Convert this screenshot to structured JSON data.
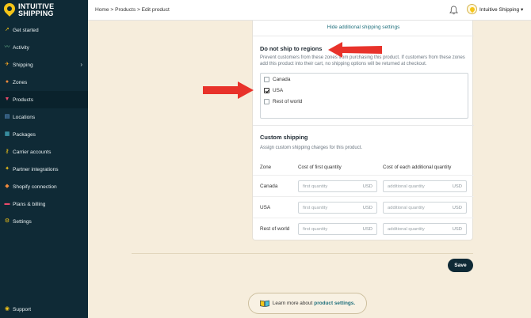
{
  "brand": {
    "line1": "INTUITIVE",
    "line2": "SHIPPING"
  },
  "sidebar": {
    "items": [
      {
        "label": "Get started",
        "icon": "rocket-icon"
      },
      {
        "label": "Activity",
        "icon": "activity-icon"
      },
      {
        "label": "Shipping",
        "icon": "shipping-icon",
        "chevron": "›"
      },
      {
        "label": "Zones",
        "icon": "globe-icon"
      },
      {
        "label": "Products",
        "icon": "shirt-icon"
      },
      {
        "label": "Locations",
        "icon": "building-icon"
      },
      {
        "label": "Packages",
        "icon": "boxes-icon"
      },
      {
        "label": "Carrier accounts",
        "icon": "key-icon"
      },
      {
        "label": "Partner integrations",
        "icon": "sparkle-icon"
      },
      {
        "label": "Shopify connection",
        "icon": "shopify-icon"
      },
      {
        "label": "Plans & billing",
        "icon": "card-icon"
      },
      {
        "label": "Settings",
        "icon": "gear-icon"
      }
    ],
    "support": "Support"
  },
  "topbar": {
    "breadcrumb": "Home > Products > Edit product",
    "account": "Intuitive Shipping ▾"
  },
  "card": {
    "hide_link": "Hide additional shipping settings",
    "regions": {
      "title": "Do not ship to regions",
      "description": "Prevent customers from these zones from purchasing this product. If customers from these zones add this product into their cart, no shipping options will be returned at checkout.",
      "options": [
        {
          "label": "Canada",
          "checked": false
        },
        {
          "label": "USA",
          "checked": true
        },
        {
          "label": "Rest of world",
          "checked": false
        }
      ]
    },
    "custom": {
      "title": "Custom shipping",
      "description": "Assign custom shipping charges for this product.",
      "headers": [
        "Zone",
        "Cost of first quantity",
        "Cost of each additional quantity"
      ],
      "rows": [
        {
          "zone": "Canada",
          "first_placeholder": "first quantity",
          "additional_placeholder": "additional quantity",
          "currency": "USD"
        },
        {
          "zone": "USA",
          "first_placeholder": "first quantity",
          "additional_placeholder": "additional quantity",
          "currency": "USD"
        },
        {
          "zone": "Rest of world",
          "first_placeholder": "first quantity",
          "additional_placeholder": "additional quantity",
          "currency": "USD"
        }
      ]
    }
  },
  "save_label": "Save",
  "learn": {
    "text": "Learn more about ",
    "link": "product settings."
  },
  "colors": {
    "sidebar": "#0f2a36",
    "accent": "#1f6f7c",
    "arrow": "#e8322a",
    "background": "#f6eddc"
  }
}
